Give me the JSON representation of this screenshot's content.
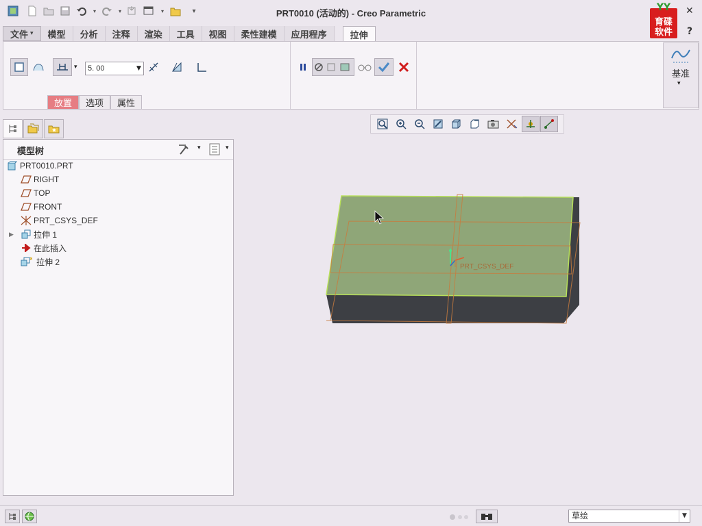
{
  "window": {
    "title": "PRT0010 (活动的) - Creo Parametric",
    "logo_text_top": "YY",
    "logo_text": "育碟软件",
    "close_glyph": "✕",
    "help_glyph": "?"
  },
  "tabs": [
    {
      "label": "文件",
      "dropdown": "▾"
    },
    {
      "label": "模型"
    },
    {
      "label": "分析"
    },
    {
      "label": "注释"
    },
    {
      "label": "渲染"
    },
    {
      "label": "工具"
    },
    {
      "label": "视图"
    },
    {
      "label": "柔性建模"
    },
    {
      "label": "应用程序"
    },
    {
      "label": "拉伸"
    }
  ],
  "ribbon": {
    "depth_value": "5. 00",
    "subtabs": [
      "放置",
      "选项",
      "属性"
    ],
    "datum_label": "基准"
  },
  "model_tree": {
    "title": "模型树",
    "items": [
      {
        "label": "PRT0010.PRT",
        "icon": "part-icon"
      },
      {
        "label": "RIGHT",
        "icon": "datum-plane-icon"
      },
      {
        "label": "TOP",
        "icon": "datum-plane-icon"
      },
      {
        "label": "FRONT",
        "icon": "datum-plane-icon"
      },
      {
        "label": "PRT_CSYS_DEF",
        "icon": "csys-icon"
      },
      {
        "label": "拉伸 1",
        "icon": "extrude-icon",
        "expand": "▶"
      },
      {
        "label": "在此插入",
        "icon": "insert-arrow-icon"
      },
      {
        "label": "拉伸 2",
        "icon": "extrude-new-icon"
      }
    ]
  },
  "graphics": {
    "csys_label": "PRT_CSYS_DEF",
    "colors": {
      "top_face": "#8fa678",
      "side_face": "#3d3f44",
      "edge": "#b8e05a",
      "datum": "#c87c3e"
    }
  },
  "status": {
    "mode_value": "草绘"
  },
  "colors": {
    "accent": "#e67d83",
    "background": "#ece7ee"
  }
}
